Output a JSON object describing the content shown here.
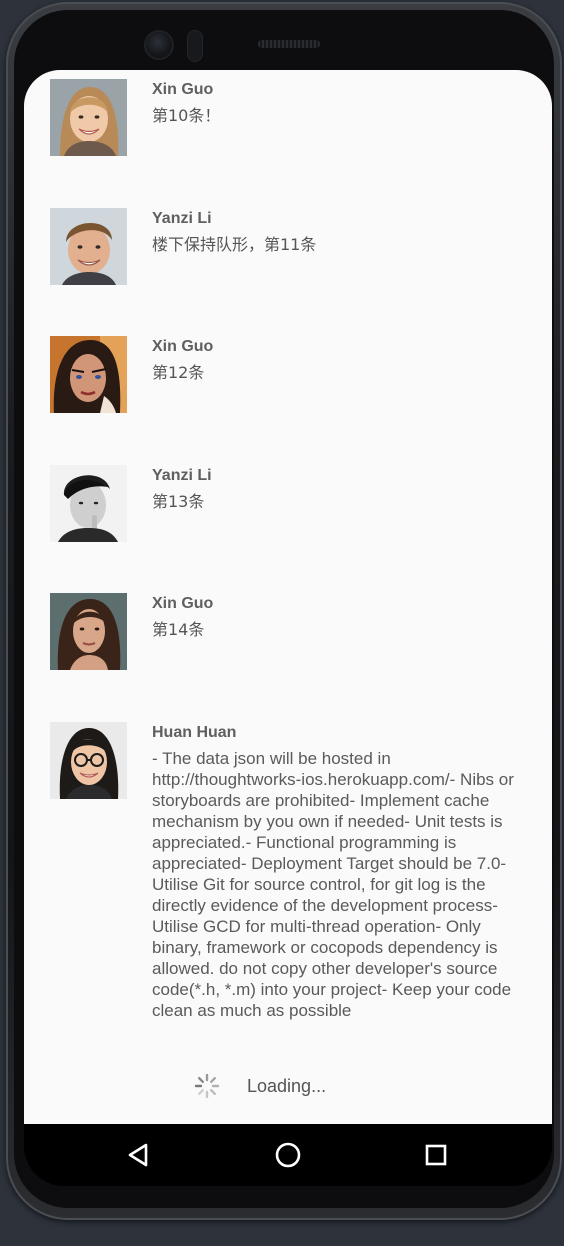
{
  "feed": {
    "items": [
      {
        "name": "Xin Guo",
        "content": "第10条！",
        "avatar_icon": "avatar-woman-blonde-icon"
      },
      {
        "name": "Yanzi Li",
        "content": "楼下保持队形，第11条",
        "avatar_icon": "avatar-man-smiling-icon"
      },
      {
        "name": "Xin Guo",
        "content": "第12条",
        "avatar_icon": "avatar-woman-portrait-icon"
      },
      {
        "name": "Yanzi Li",
        "content": "第13条",
        "avatar_icon": "avatar-man-bw-icon"
      },
      {
        "name": "Xin Guo",
        "content": "第14条",
        "avatar_icon": "avatar-woman-dark-hair-icon"
      },
      {
        "name": "Huan Huan",
        "content": "- The data json will be hosted in http://thoughtworks-ios.herokuapp.com/- Nibs or storyboards are prohibited- Implement cache mechanism by you own if needed- Unit tests is appreciated.- Functional programming is appreciated- Deployment Target should be 7.0- Utilise Git for source control, for git log is the directly evidence of the development process- Utilise GCD for multi-thread operation- Only binary, framework or cocopods dependency is allowed. do not copy other developer's source code(*.h, *.m) into your project- Keep your code clean as much as possible",
        "avatar_icon": "avatar-woman-glasses-icon"
      }
    ]
  },
  "loading": {
    "text": "Loading..."
  },
  "navbar": {
    "back_icon": "back-triangle-icon",
    "home_icon": "home-circle-icon",
    "recents_icon": "recents-square-icon"
  },
  "colors": {
    "screen_bg": "#fafafa",
    "name_text": "#5f5f5f",
    "content_text": "#555555",
    "navbar_bg": "#000000"
  }
}
